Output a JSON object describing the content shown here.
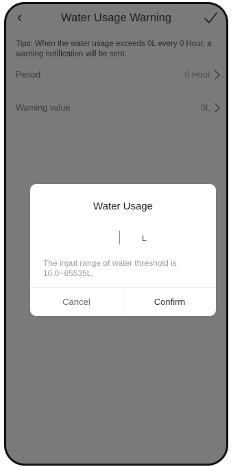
{
  "header": {
    "back_icon": "‹",
    "title": "Water Usage Warning",
    "confirm_icon": "checkmark-icon"
  },
  "tips": "Tips: When the water usage exceeds 0L every 0 Hour, a warning notification will be sent.",
  "settings": [
    {
      "label": "Period",
      "value": "0 Hour"
    },
    {
      "label": "Warning value",
      "value": "0L"
    }
  ],
  "dialog": {
    "title": "Water Usage",
    "input_value": "",
    "unit": "L",
    "help_text": "The input range of water threshold is 10.0~65535L.",
    "cancel_label": "Cancel",
    "confirm_label": "Confirm"
  },
  "colors": {
    "overlay": "#7a7a7a",
    "dialog_bg": "#ffffff"
  }
}
